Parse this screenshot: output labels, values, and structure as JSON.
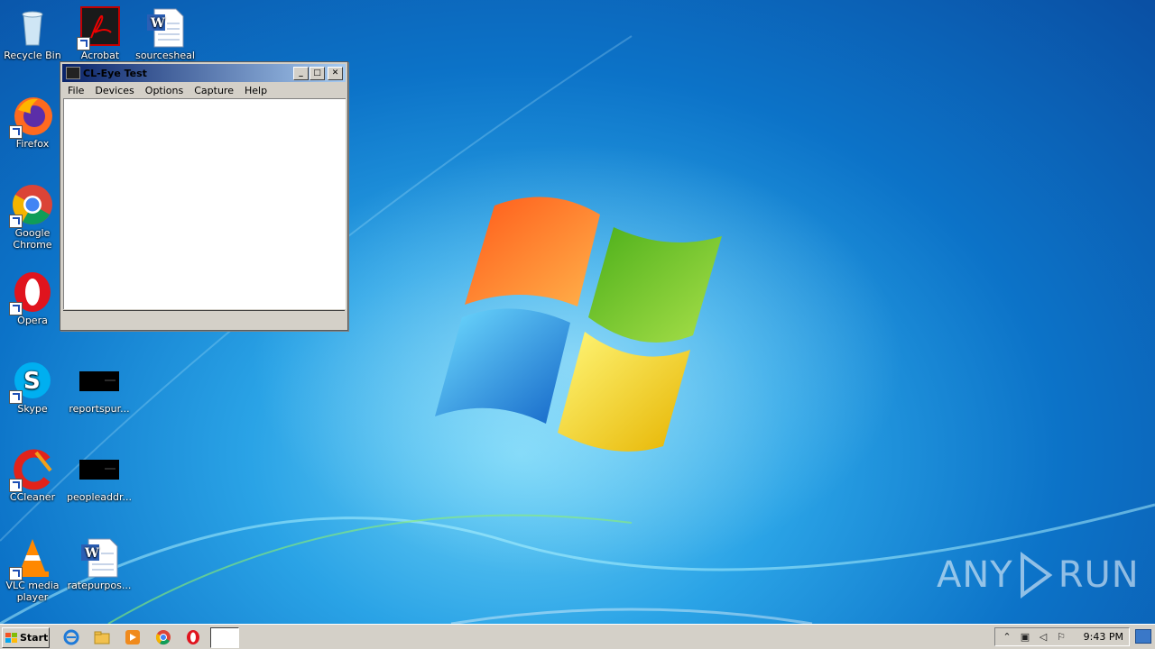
{
  "desktop": {
    "icons": [
      {
        "name": "recycle-bin",
        "label": "Recycle Bin"
      },
      {
        "name": "acrobat",
        "label": "Acrobat"
      },
      {
        "name": "sourcesheal",
        "label": "sourcesheal"
      },
      {
        "name": "firefox",
        "label": "Firefox"
      },
      {
        "name": "google-chrome",
        "label": "Google Chrome"
      },
      {
        "name": "opera",
        "label": "Opera"
      },
      {
        "name": "skype",
        "label": "Skype"
      },
      {
        "name": "reportspur",
        "label": "reportspur..."
      },
      {
        "name": "ccleaner",
        "label": "CCleaner"
      },
      {
        "name": "peopleaddr",
        "label": "peopleaddr..."
      },
      {
        "name": "vlc",
        "label": "VLC media player"
      },
      {
        "name": "ratepurpose",
        "label": "ratepurpos..."
      }
    ]
  },
  "window": {
    "title": "CL-Eye Test",
    "minimize": "_",
    "maximize": "□",
    "close": "✕",
    "menu": [
      "File",
      "Devices",
      "Options",
      "Capture",
      "Help"
    ]
  },
  "taskbar": {
    "start_label": "Start",
    "clock": "9:43 PM",
    "tray_icons": [
      "chevron-up-icon",
      "network-icon",
      "volume-icon",
      "flag-icon"
    ]
  },
  "watermark": {
    "left": "ANY",
    "right": "RUN"
  }
}
